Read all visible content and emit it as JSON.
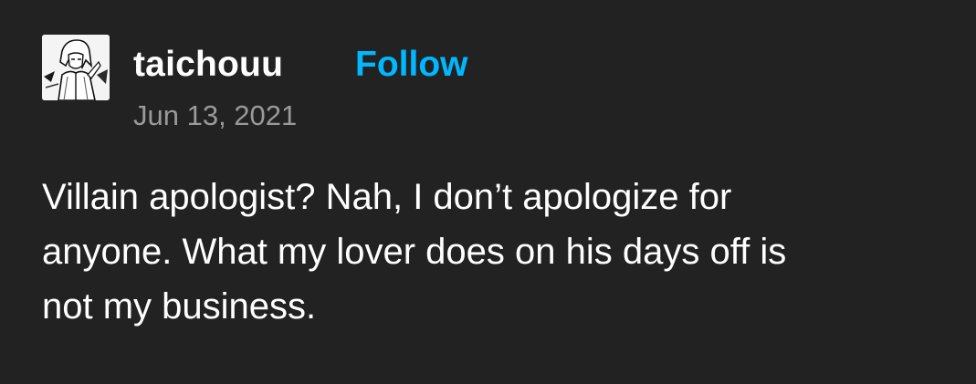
{
  "post": {
    "username": "taichouu",
    "follow_label": "Follow",
    "date": "Jun 13, 2021",
    "body_lines": [
      "Villain apologist? Nah, I don’t apologize for",
      "anyone. What my lover does on his days off is",
      "not my business."
    ],
    "avatar_icon": "manga-character-avatar"
  },
  "colors": {
    "background": "#222222",
    "text": "#ffffff",
    "accent": "#00b8ff",
    "muted": "#9a9a9a"
  }
}
